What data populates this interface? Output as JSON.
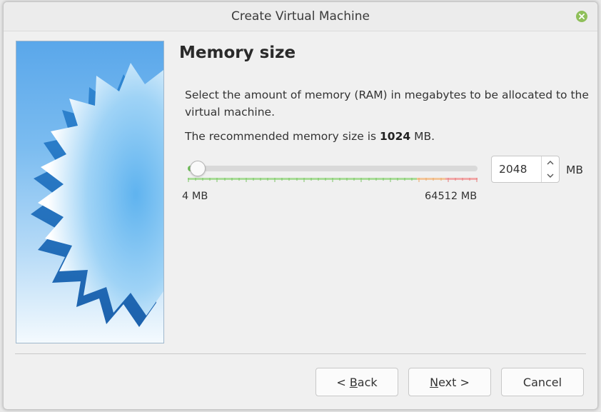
{
  "window": {
    "title": "Create Virtual Machine",
    "close_icon": "close-icon",
    "accent_color": "#8fbf5a"
  },
  "page": {
    "heading": "Memory size",
    "description": "Select the amount of memory (RAM) in megabytes to be allocated to the virtual machine.",
    "recommend_prefix": "The recommended memory size is ",
    "recommend_value": "1024",
    "recommend_suffix": " MB."
  },
  "memory": {
    "slider_min_label": "4 MB",
    "slider_max_label": "64512 MB",
    "slider_min": 4,
    "slider_max": 64512,
    "value": 2048,
    "value_text": "2048",
    "unit": "MB",
    "spin_up_icon": "chevron-up-icon",
    "spin_down_icon": "chevron-down-icon"
  },
  "buttons": {
    "back_prefix": "< ",
    "back_mnemonic": "B",
    "back_rest": "ack",
    "next_mnemonic": "N",
    "next_rest": "ext >",
    "cancel": "Cancel"
  }
}
